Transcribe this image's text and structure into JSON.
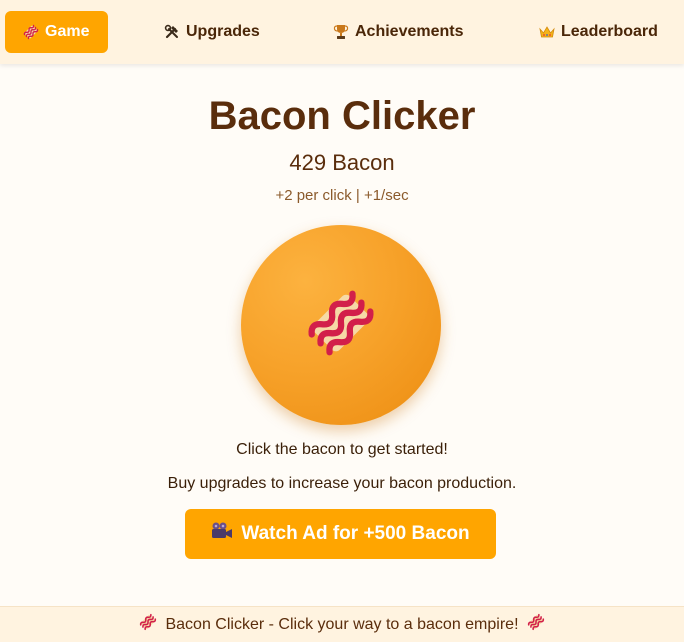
{
  "nav": {
    "items": [
      {
        "label": "Game",
        "icon": "bacon-icon",
        "active": true
      },
      {
        "label": "Upgrades",
        "icon": "hammer-wrench-icon",
        "active": false
      },
      {
        "label": "Achievements",
        "icon": "trophy-icon",
        "active": false
      },
      {
        "label": "Leaderboard",
        "icon": "crown-icon",
        "active": false
      }
    ]
  },
  "game": {
    "title": "Bacon Clicker",
    "count_text": "429 Bacon",
    "rate_text": "+2 per click | +1/sec",
    "message_start": "Click the bacon to get started!",
    "message_upgrades": "Buy upgrades to increase your bacon production.",
    "ad_button_label": "Watch Ad for +500 Bacon",
    "ad_icon": "video-camera-icon",
    "click_icon": "bacon-icon"
  },
  "footer": {
    "text": "Bacon Clicker - Click your way to a bacon empire!"
  },
  "colors": {
    "accent": "#ffa500",
    "nav_bg": "#fff3e0",
    "text_brown": "#5a2d0c",
    "page_bg": "#fffcf7"
  }
}
